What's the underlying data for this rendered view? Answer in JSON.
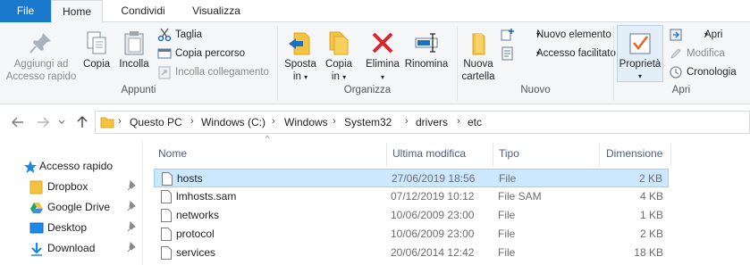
{
  "tabs": {
    "file": "File",
    "home": "Home",
    "share": "Condividi",
    "view": "Visualizza"
  },
  "ribbon": {
    "clipboard": {
      "group_label": "Appunti",
      "pin_label_1": "Aggiungi ad",
      "pin_label_2": "Accesso rapido",
      "copy": "Copia",
      "paste": "Incolla",
      "cut": "Taglia",
      "copy_path": "Copia percorso",
      "paste_shortcut": "Incolla collegamento"
    },
    "organize": {
      "group_label": "Organizza",
      "move_1": "Sposta",
      "move_2": "in",
      "copy_1": "Copia",
      "copy_2": "in",
      "delete": "Elimina",
      "rename": "Rinomina"
    },
    "new": {
      "group_label": "Nuovo",
      "new_folder_1": "Nuova",
      "new_folder_2": "cartella",
      "new_item": "Nuovo elemento",
      "easy_access": "Accesso facilitato"
    },
    "open": {
      "group_label": "Apri",
      "properties": "Proprietà",
      "open": "Apri",
      "edit": "Modifica",
      "history": "Cronologia"
    }
  },
  "address": {
    "crumbs": [
      "Questo PC",
      "Windows (C:)",
      "Windows",
      "System32",
      "drivers",
      "etc"
    ]
  },
  "nav": {
    "items": [
      {
        "label": "Accesso rapido",
        "icon": "star-icon"
      },
      {
        "label": "Dropbox",
        "icon": "folder-icon"
      },
      {
        "label": "Google Drive",
        "icon": "google-drive-icon"
      },
      {
        "label": "Desktop",
        "icon": "desktop-icon"
      },
      {
        "label": "Download",
        "icon": "download-icon"
      }
    ]
  },
  "columns": {
    "name": "Nome",
    "modified": "Ultima modifica",
    "type": "Tipo",
    "size": "Dimensione"
  },
  "files": [
    {
      "name": "hosts",
      "modified": "27/06/2019 18:56",
      "type": "File",
      "size": "2 KB",
      "selected": true
    },
    {
      "name": "lmhosts.sam",
      "modified": "07/12/2019 10:12",
      "type": "File SAM",
      "size": "4 KB"
    },
    {
      "name": "networks",
      "modified": "10/06/2009 23:00",
      "type": "File",
      "size": "1 KB"
    },
    {
      "name": "protocol",
      "modified": "10/06/2009 23:00",
      "type": "File",
      "size": "2 KB"
    },
    {
      "name": "services",
      "modified": "20/06/2014 12:42",
      "type": "File",
      "size": "18 KB"
    }
  ],
  "colors": {
    "file_tab": "#1979ca",
    "selection": "#cce8ff",
    "delete_red": "#d9262e",
    "folder_yellow": "#f5c342"
  }
}
